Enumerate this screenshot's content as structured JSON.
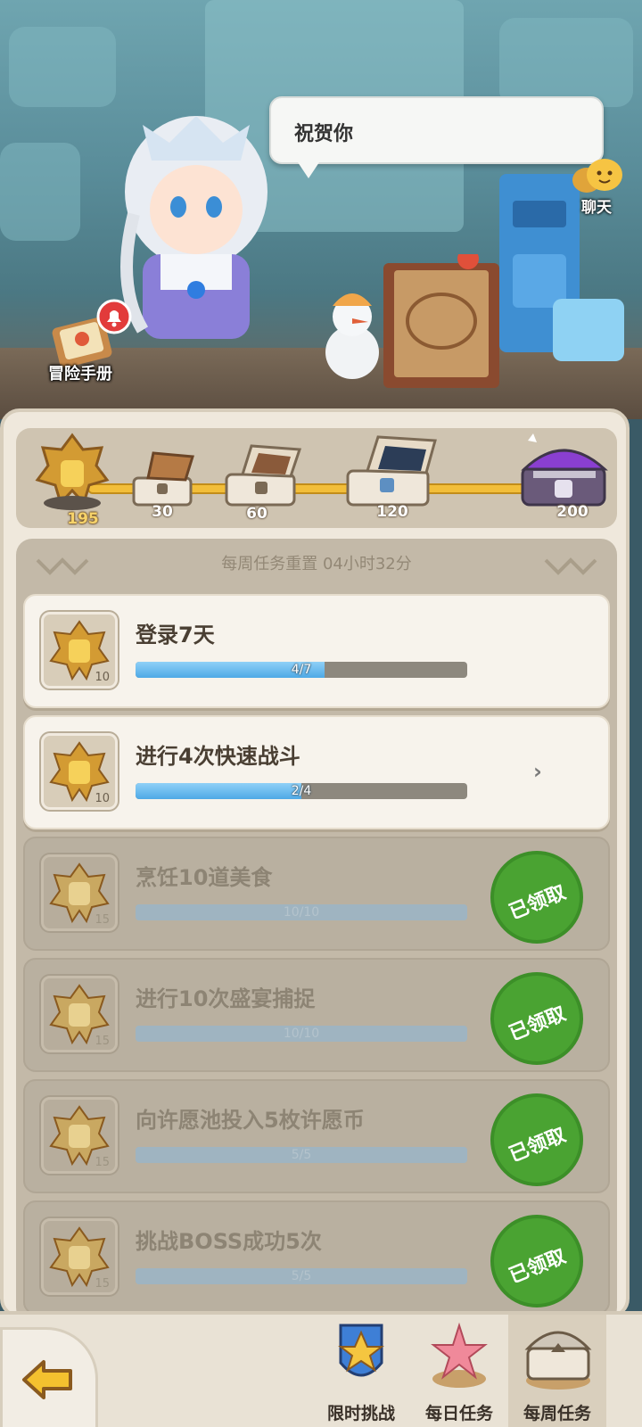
{
  "speech": {
    "text": "祝贺你"
  },
  "chat": {
    "label": "聊天"
  },
  "manual": {
    "label": "冒险手册"
  },
  "progress": {
    "current_points": "195",
    "milestones": [
      {
        "value": "30"
      },
      {
        "value": "60"
      },
      {
        "value": "120"
      },
      {
        "value": "200"
      }
    ]
  },
  "weekly": {
    "reset_text": "每周任务重置 04小时32分"
  },
  "tasks": [
    {
      "title": "登录7天",
      "progress_text": "4/7",
      "progress": 0.571,
      "reward": "10",
      "state": "active"
    },
    {
      "title": "进行4次快速战斗",
      "progress_text": "2/4",
      "progress": 0.5,
      "reward": "10",
      "state": "active"
    },
    {
      "title": "烹饪10道美食",
      "progress_text": "10/10",
      "progress": 1.0,
      "reward": "15",
      "state": "claimed",
      "claimed_label": "已领取"
    },
    {
      "title": "进行10次盛宴捕捉",
      "progress_text": "10/10",
      "progress": 1.0,
      "reward": "15",
      "state": "claimed",
      "claimed_label": "已领取"
    },
    {
      "title": "向许愿池投入5枚许愿币",
      "progress_text": "5/5",
      "progress": 1.0,
      "reward": "15",
      "state": "claimed",
      "claimed_label": "已领取"
    },
    {
      "title": "挑战BOSS成功5次",
      "progress_text": "5/5",
      "progress": 1.0,
      "reward": "15",
      "state": "claimed",
      "claimed_label": "已领取"
    }
  ],
  "nav": {
    "tabs": [
      {
        "label": "限时挑战",
        "icon": "trophy-star-icon"
      },
      {
        "label": "每日任务",
        "icon": "starfish-icon"
      },
      {
        "label": "每周任务",
        "icon": "chest-icon",
        "selected": true
      }
    ],
    "back_icon": "back-arrow-icon"
  },
  "colors": {
    "accent": "#f2be3a",
    "claimed": "#4aa332",
    "progress_fill": "#4ea9e6"
  }
}
